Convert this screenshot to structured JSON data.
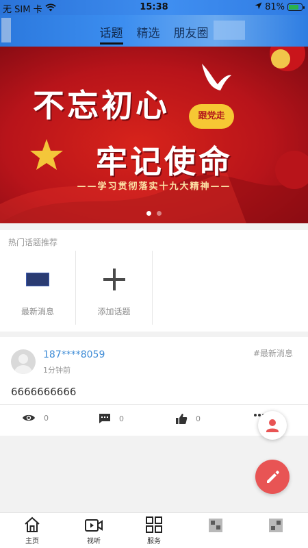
{
  "status_bar": {
    "carrier": "无 SIM 卡",
    "time": "15:38",
    "battery_percent": "81%",
    "battery_level": 0.81,
    "icons": [
      "wifi-icon",
      "location-arrow-icon",
      "battery-icon"
    ]
  },
  "top_tabs": [
    {
      "label": "话题",
      "active": true
    },
    {
      "label": "精选",
      "active": false
    },
    {
      "label": "朋友圈",
      "active": false
    }
  ],
  "banner": {
    "line1": "不忘初心",
    "seal": "跟党走",
    "line2": "牢记使命",
    "slogan": "——学习贯彻落实十九大精神——",
    "slide_count": 2,
    "active_slide": 1
  },
  "hot_topics": {
    "title": "热门话题推荐",
    "items": [
      {
        "label": "最新消息",
        "icon": "topic-thumbnail"
      },
      {
        "label": "添加话题",
        "icon": "plus-icon"
      }
    ]
  },
  "post": {
    "username": "187****8059",
    "time": "1分钟前",
    "tag": "#最新消息",
    "content": "6666666666",
    "actions": [
      {
        "icon": "eye-icon",
        "count": "0"
      },
      {
        "icon": "comment-icon",
        "count": "0"
      },
      {
        "icon": "thumb-up-icon",
        "count": "0"
      }
    ]
  },
  "fabs": [
    {
      "icon": "user-icon"
    },
    {
      "icon": "pencil-icon"
    }
  ],
  "bottom_nav": [
    {
      "label": "主页",
      "icon": "home-icon"
    },
    {
      "label": "视听",
      "icon": "video-icon"
    },
    {
      "label": "服务",
      "icon": "grid-icon"
    }
  ],
  "colors": {
    "accent_blue": "#3d8bd6",
    "fab_red": "#e85454",
    "banner_red": "#c81b1e"
  }
}
